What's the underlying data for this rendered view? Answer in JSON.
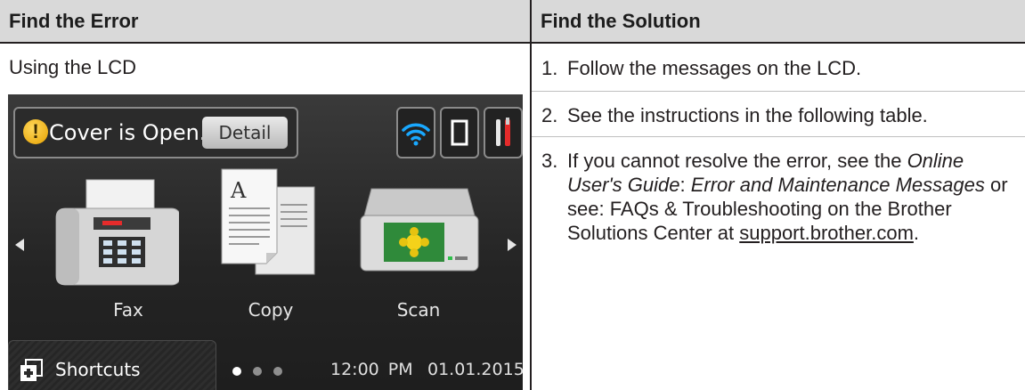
{
  "table": {
    "col_left_header": "Find the Error",
    "col_right_header": "Find the Solution",
    "left_heading": "Using the LCD"
  },
  "lcd": {
    "status_message": "Cover is Open.",
    "warning_symbol": "!",
    "detail_button": "Detail",
    "apps": [
      {
        "label": "Fax",
        "icon": "fax-icon"
      },
      {
        "label": "Copy",
        "icon": "copy-icon"
      },
      {
        "label": "Scan",
        "icon": "scan-icon"
      }
    ],
    "shortcuts_label": "Shortcuts",
    "time": "12:00 PM",
    "date": "01.01.2015",
    "page_dots": {
      "count": 3,
      "active": 0
    },
    "top_icons": [
      "wifi-icon",
      "memory-card-icon",
      "tools-icon"
    ],
    "colors": {
      "screen_bg": "#242424",
      "wifi": "#19a8ff",
      "warning": "#f0b400",
      "tool_red": "#e52b2b"
    }
  },
  "solution": {
    "steps": [
      {
        "num": "1.",
        "text": "Follow the messages on the LCD."
      },
      {
        "num": "2.",
        "text": "See the instructions in the following table."
      },
      {
        "num": "3.",
        "pre": "If you cannot resolve the error, see the ",
        "guide": "Online User's Guide",
        "colon": ": ",
        "topic": "Error and Maintenance Messages",
        "mid": " or see: FAQs & Troubleshooting on the Brother Solutions Center at ",
        "link": "support.brother.com",
        "end": "."
      }
    ]
  },
  "colors": {
    "header_bg": "#d9d9d9",
    "text": "#231f20"
  }
}
